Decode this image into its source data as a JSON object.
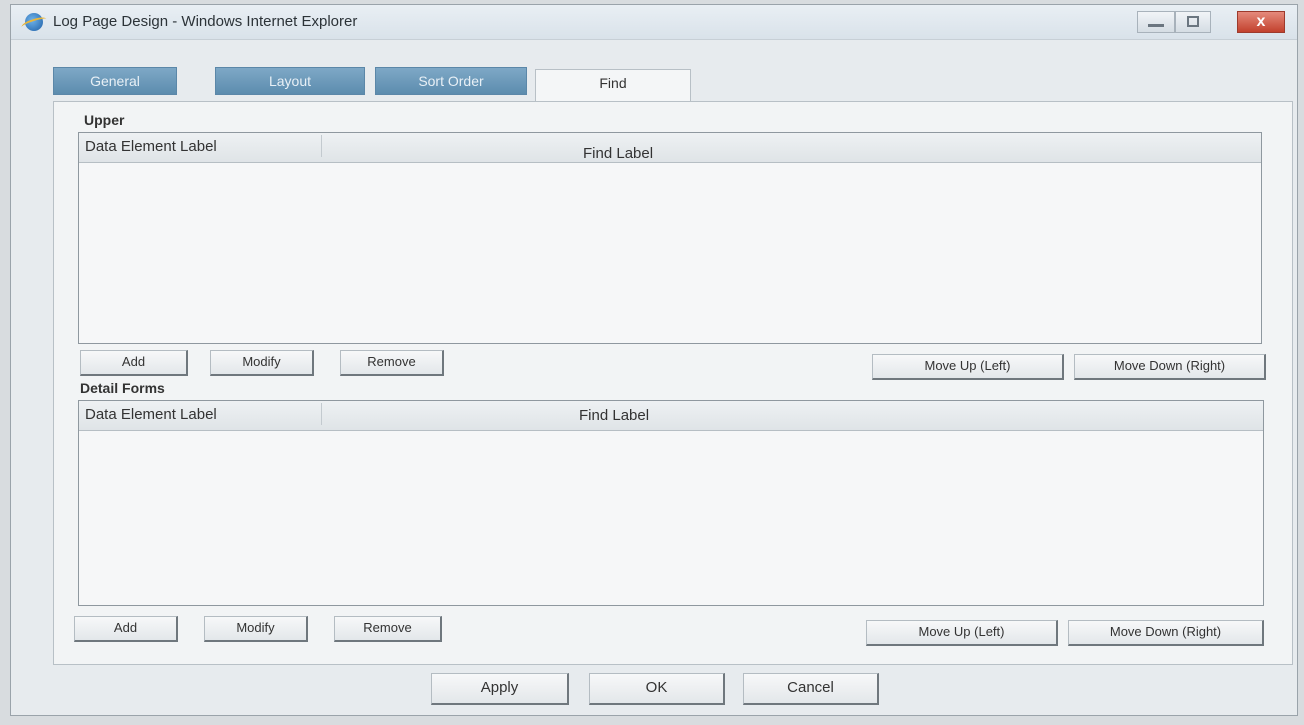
{
  "window": {
    "title": "Log Page Design - Windows Internet Explorer",
    "close_glyph": "x"
  },
  "tabs": [
    {
      "label": "General",
      "active": false
    },
    {
      "label": "Layout",
      "active": false
    },
    {
      "label": "Sort Order",
      "active": false
    },
    {
      "label": "Find",
      "active": true
    }
  ],
  "upper": {
    "label": "Upper",
    "columns": [
      "Data Element Label",
      "Find Label"
    ],
    "rows": [],
    "buttons": {
      "add": "Add",
      "modify": "Modify",
      "remove": "Remove",
      "move_up": "Move Up (Left)",
      "move_down": "Move Down (Right)"
    }
  },
  "detail": {
    "label": "Detail Forms",
    "columns": [
      "Data Element Label",
      "Find Label"
    ],
    "rows": [],
    "buttons": {
      "add": "Add",
      "modify": "Modify",
      "remove": "Remove",
      "move_up": "Move Up (Left)",
      "move_down": "Move Down (Right)"
    }
  },
  "footer": {
    "apply": "Apply",
    "ok": "OK",
    "cancel": "Cancel"
  },
  "icons": {
    "app": "internet-explorer-icon",
    "minimize": "minimize-icon",
    "maximize": "maximize-icon",
    "close": "close-icon"
  },
  "colors": {
    "inactive_tab": "#6f9bbb",
    "close_button": "#c94a36"
  }
}
